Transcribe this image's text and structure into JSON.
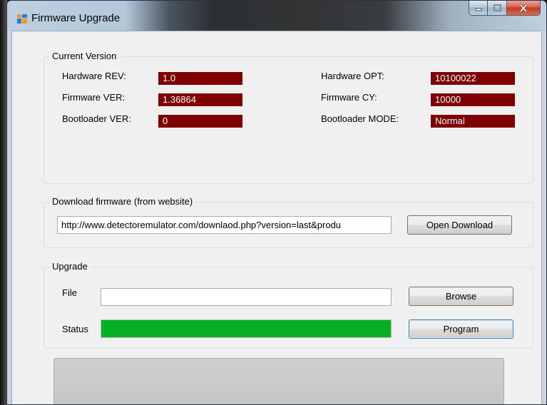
{
  "window": {
    "title": "Firmware Upgrade",
    "icons": {
      "app": "app-icon",
      "minimize": "minimize-icon",
      "maximize": "maximize-icon",
      "close": "close-icon"
    }
  },
  "current_version": {
    "legend": "Current Version",
    "hardware_rev": {
      "label": "Hardware REV:",
      "value": "1.0"
    },
    "firmware_ver": {
      "label": "Firmware VER:",
      "value": "1.36864"
    },
    "bootloader_ver": {
      "label": "Bootloader VER:",
      "value": "0"
    },
    "hardware_opt": {
      "label": "Hardware OPT:",
      "value": "10100022"
    },
    "firmware_cy": {
      "label": "Firmware CY:",
      "value": "10000"
    },
    "bootloader_mode": {
      "label": "Bootloader MODE:",
      "value": "Normal"
    }
  },
  "download": {
    "legend": "Download firmware (from website)",
    "url": "http://www.detectoremulator.com/downlaod.php?version=last&produ",
    "open_button": "Open Download"
  },
  "upgrade": {
    "legend": "Upgrade",
    "file_label": "File",
    "file_value": "",
    "browse_button": "Browse",
    "status_label": "Status",
    "status_progress": 1.0,
    "program_button": "Program"
  },
  "colors": {
    "value_background": "#7f0000",
    "progress_green": "#06b025",
    "close_button_red": "#c4391f"
  }
}
